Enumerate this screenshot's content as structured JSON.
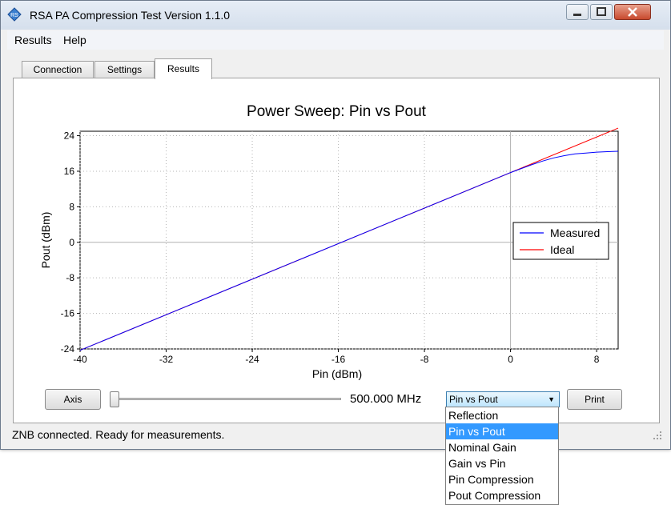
{
  "window": {
    "title": "RSA PA Compression Test Version 1.1.0",
    "icon": "rohde-schwarz-logo-icon"
  },
  "menu": [
    "Results",
    "Help"
  ],
  "tabs": [
    {
      "label": "Connection",
      "active": false
    },
    {
      "label": "Settings",
      "active": false
    },
    {
      "label": "Results",
      "active": true
    }
  ],
  "chart_data": {
    "type": "line",
    "title": "Power Sweep: Pin vs Pout",
    "xlabel": "Pin (dBm)",
    "ylabel": "Pout (dBm)",
    "xlim": [
      -40,
      10
    ],
    "ylim": [
      -24,
      25
    ],
    "xticks": [
      -40,
      -32,
      -24,
      -16,
      -8,
      0,
      8
    ],
    "yticks": [
      24,
      16,
      8,
      0,
      -8,
      -16,
      -24
    ],
    "grid": true,
    "legend_position": "right",
    "series": [
      {
        "name": "Measured",
        "color": "#0000ff",
        "x": [
          -40,
          -30,
          -20,
          -10,
          -5,
          0,
          1,
          2,
          3,
          4,
          5,
          6,
          7,
          8,
          9,
          10
        ],
        "y": [
          -24.3,
          -14.3,
          -4.3,
          5.7,
          10.7,
          15.7,
          16.6,
          17.5,
          18.3,
          19.0,
          19.5,
          19.9,
          20.1,
          20.3,
          20.4,
          20.5
        ]
      },
      {
        "name": "Ideal",
        "color": "#ff0000",
        "x": [
          -40,
          10
        ],
        "y": [
          -24.3,
          25.7
        ]
      }
    ]
  },
  "controls": {
    "axis_button": "Axis",
    "frequency": "500.000 MHz",
    "frequency_slider_position": 0.0,
    "plot_select": "Pin vs Pout",
    "plot_options": [
      "Reflection",
      "Pin vs Pout",
      "Nominal Gain",
      "Gain vs Pin",
      "Pin Compression",
      "Pout Compression"
    ],
    "print_button": "Print"
  },
  "status": {
    "text": "ZNB connected. Ready for measurements."
  }
}
